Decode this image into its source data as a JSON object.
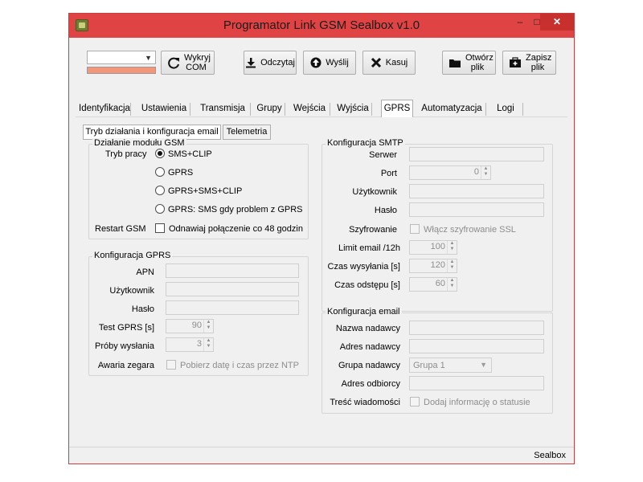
{
  "window": {
    "title": "Programator Link GSM Sealbox v1.0",
    "minimize": "–",
    "maximize": "□",
    "close": "✕"
  },
  "toolbar": {
    "com_combo_value": "",
    "progress_percent": 100,
    "detect_com_label": "Wykryj COM",
    "read_label": "Odczytaj",
    "send_label": "Wyślij",
    "delete_label": "Kasuj",
    "open_file_label": "Otwórz plik",
    "save_file_label": "Zapisz plik"
  },
  "tabs": [
    "Identyfikacja",
    "Ustawienia",
    "Transmisja",
    "Grupy",
    "Wejścia",
    "Wyjścia",
    "GPRS",
    "Automatyzacja",
    "Logi"
  ],
  "active_tab": "GPRS",
  "subtabs": [
    "Tryb działania i konfiguracja email",
    "Telemetria"
  ],
  "gsm": {
    "title": "Działanie modułu GSM",
    "mode_label": "Tryb pracy",
    "modes": [
      "SMS+CLIP",
      "GPRS",
      "GPRS+SMS+CLIP",
      "GPRS: SMS gdy problem z GPRS"
    ],
    "selected_mode": "SMS+CLIP",
    "restart_label": "Restart GSM",
    "restart_checkbox": "Odnawiaj połączenie co 48 godzin"
  },
  "gprs": {
    "title": "Konfiguracja GPRS",
    "apn_label": "APN",
    "user_label": "Użytkownik",
    "password_label": "Hasło",
    "test_label": "Test GPRS [s]",
    "test_value": "90",
    "attempts_label": "Próby wysłania",
    "attempts_value": "3",
    "clock_label": "Awaria zegara",
    "clock_checkbox": "Pobierz datę i czas przez NTP"
  },
  "smtp": {
    "title": "Konfiguracja SMTP",
    "server_label": "Serwer",
    "port_label": "Port",
    "port_value": "0",
    "user_label": "Użytkownik",
    "password_label": "Hasło",
    "encryption_label": "Szyfrowanie",
    "encryption_checkbox": "Włącz szyfrowanie SSL",
    "limit_label": "Limit email /12h",
    "limit_value": "100",
    "send_time_label": "Czas wysyłania [s]",
    "send_time_value": "120",
    "interval_label": "Czas odstępu [s]",
    "interval_value": "60"
  },
  "email": {
    "title": "Konfiguracja email",
    "sender_name_label": "Nazwa nadawcy",
    "sender_address_label": "Adres nadawcy",
    "sender_group_label": "Grupa nadawcy",
    "sender_group_value": "Grupa 1",
    "recipient_label": "Adres odbiorcy",
    "content_label": "Treść wiadomości",
    "content_checkbox": "Dodaj informację o statusie"
  },
  "statusbar": {
    "text": "Sealbox"
  }
}
